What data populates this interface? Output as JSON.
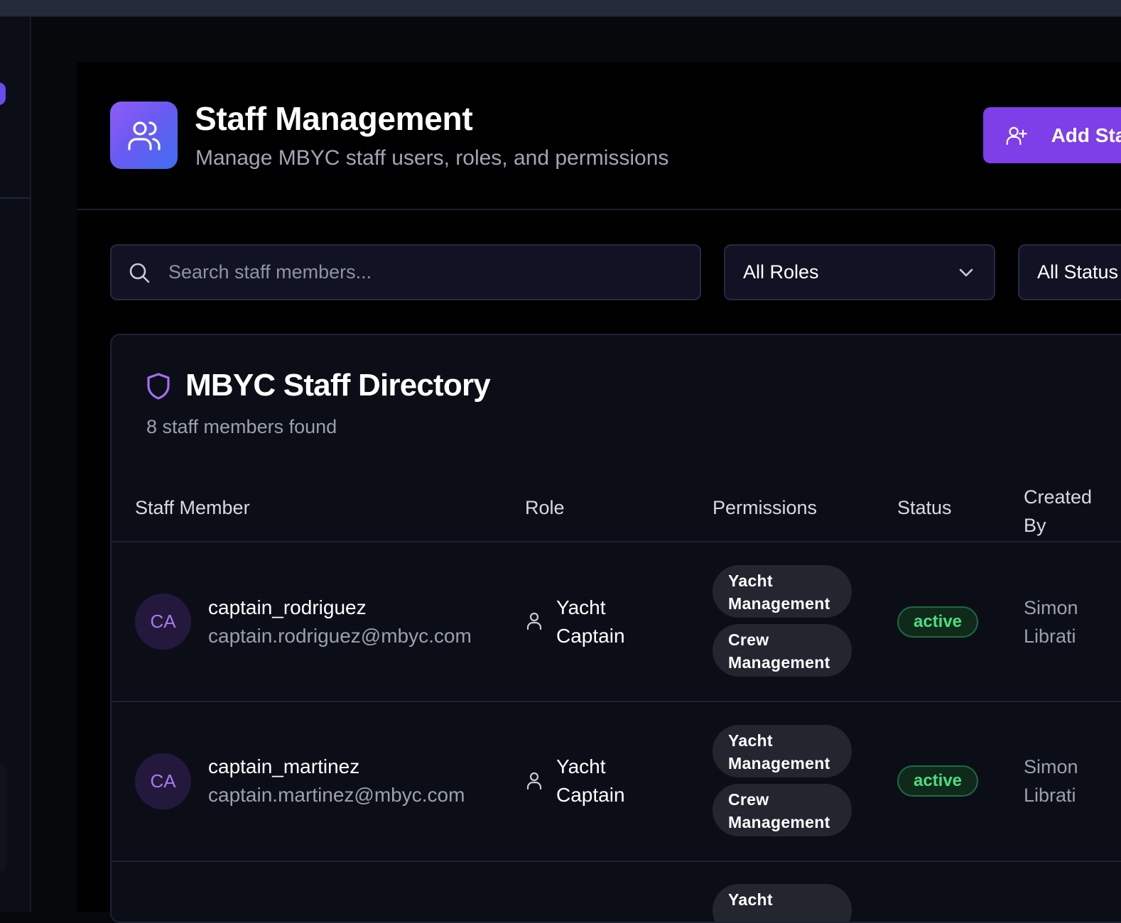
{
  "header": {
    "title": "Staff Management",
    "subtitle": "Manage MBYC staff users, roles, and permissions",
    "add_button_label": "Add Staff"
  },
  "filters": {
    "search_placeholder": "Search staff members...",
    "search_value": "",
    "roles_selected": "All Roles",
    "status_selected": "All Status"
  },
  "directory": {
    "title": "MBYC Staff Directory",
    "count_text": "8 staff members found",
    "columns": [
      "Staff Member",
      "Role",
      "Permissions",
      "Status",
      "Created By"
    ],
    "rows": [
      {
        "initials": "CA",
        "username": "captain_rodriguez",
        "email": "captain.rodriguez@mbyc.com",
        "role": "Yacht Captain",
        "permissions": [
          "Yacht Management",
          "Crew Management"
        ],
        "status": "active",
        "created_by": "Simon Librati"
      },
      {
        "initials": "CA",
        "username": "captain_martinez",
        "email": "captain.martinez@mbyc.com",
        "role": "Yacht Captain",
        "permissions": [
          "Yacht Management",
          "Crew Management"
        ],
        "status": "active",
        "created_by": "Simon Librati"
      },
      {
        "initials": "",
        "username": "",
        "email": "",
        "role": "",
        "permissions": [
          "Yacht"
        ],
        "status": "",
        "created_by": ""
      }
    ]
  },
  "icons": {
    "logo": "users-icon",
    "add": "user-plus-icon",
    "search": "search-icon",
    "dropdown": "chevron-down-icon",
    "directory": "shield-icon",
    "role": "user-icon"
  },
  "colors": {
    "accent": "#7e3ee8",
    "active_status": "#4ade80",
    "avatar_text": "#a77ce8"
  }
}
